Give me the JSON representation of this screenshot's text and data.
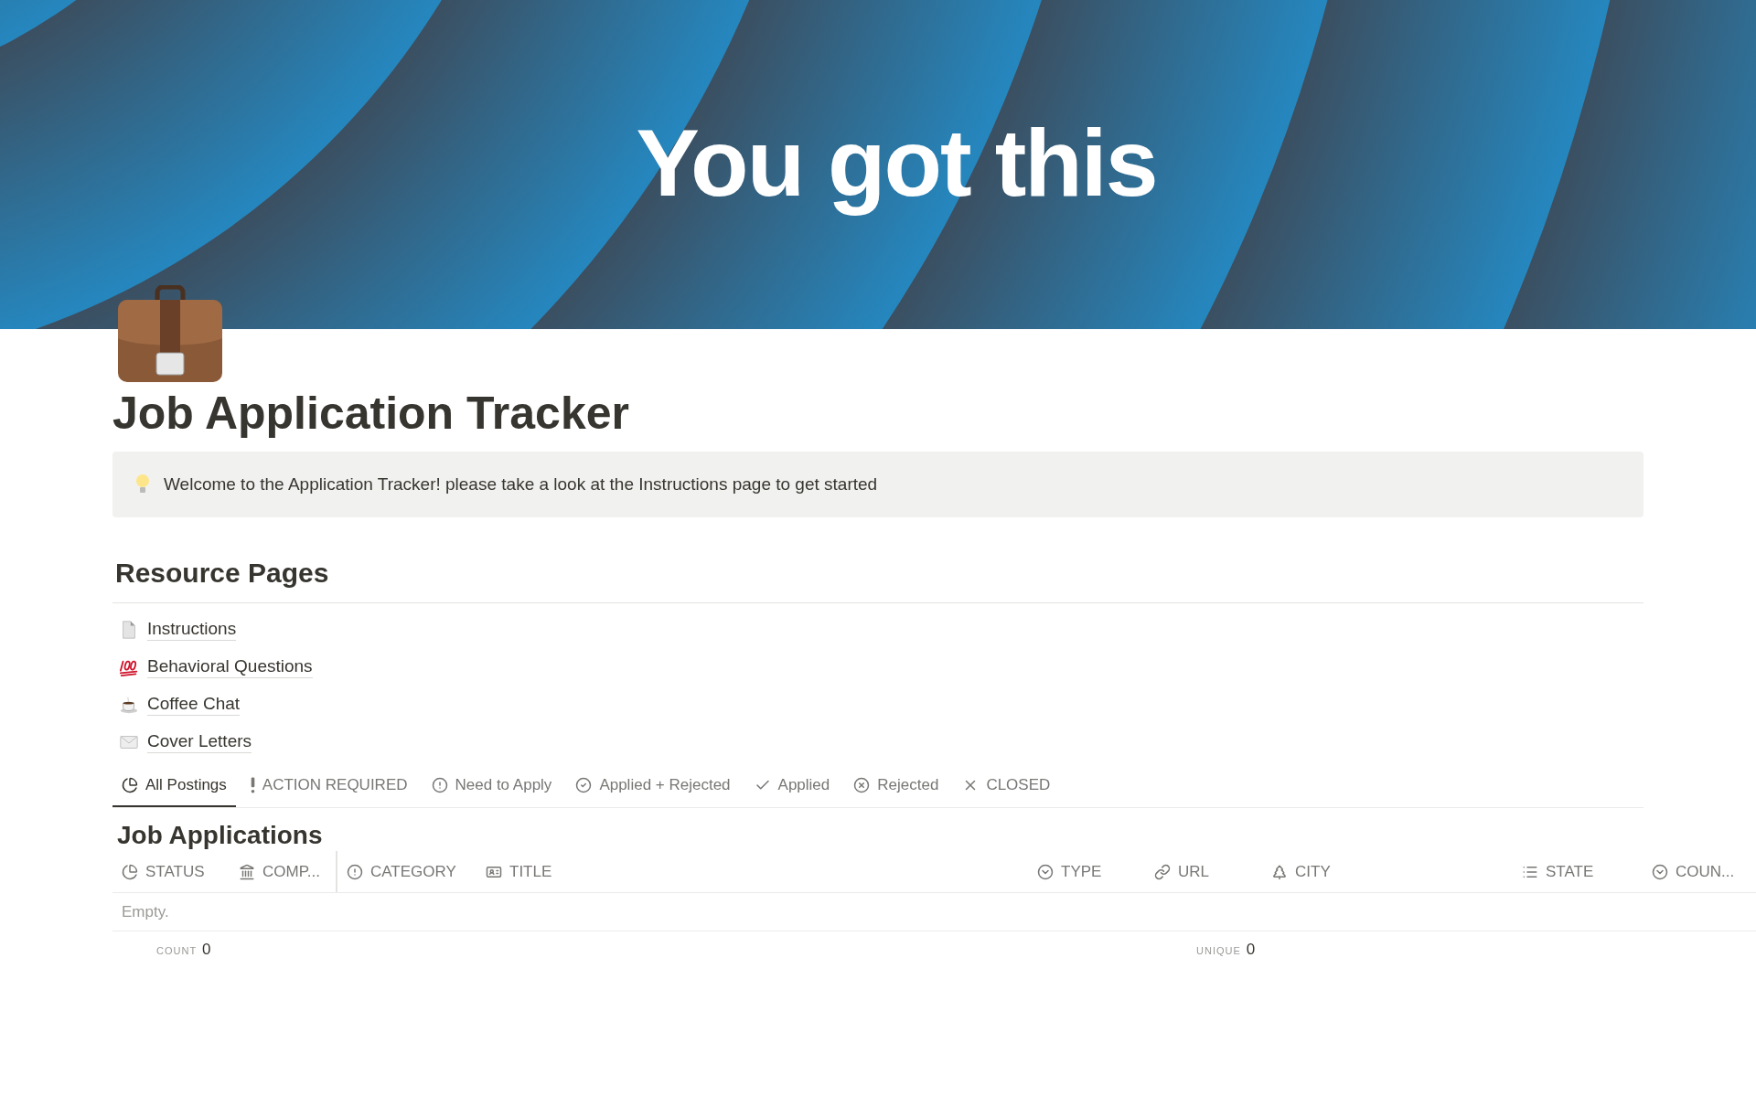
{
  "cover": {
    "title": "You got this"
  },
  "page": {
    "title": "Job Application Tracker"
  },
  "callout": {
    "text": "Welcome to the Application Tracker! please take a look at the Instructions page to get started"
  },
  "resources": {
    "heading": "Resource Pages",
    "links": [
      {
        "kind": "page",
        "label": "Instructions"
      },
      {
        "kind": "hundred",
        "label": "Behavioral Questions"
      },
      {
        "kind": "coffee",
        "label": "Coffee Chat"
      },
      {
        "kind": "envelope",
        "label": "Cover Letters"
      }
    ]
  },
  "views": [
    {
      "kind": "pie",
      "label": "All Postings",
      "selected": true
    },
    {
      "kind": "bang",
      "label": "ACTION REQUIRED",
      "selected": false
    },
    {
      "kind": "alert",
      "label": "Need to Apply",
      "selected": false
    },
    {
      "kind": "checkcircle",
      "label": "Applied + Rejected",
      "selected": false
    },
    {
      "kind": "check",
      "label": "Applied",
      "selected": false
    },
    {
      "kind": "xcircle",
      "label": "Rejected",
      "selected": false
    },
    {
      "kind": "x",
      "label": "CLOSED",
      "selected": false
    }
  ],
  "table": {
    "title": "Job Applications",
    "columns": [
      {
        "kind": "pie",
        "label": "STATUS"
      },
      {
        "kind": "bank",
        "label": "COMP..."
      },
      {
        "kind": "alert",
        "label": "CATEGORY"
      },
      {
        "kind": "card",
        "label": "TITLE"
      },
      {
        "kind": "select",
        "label": "TYPE"
      },
      {
        "kind": "link",
        "label": "URL"
      },
      {
        "kind": "tree",
        "label": "CITY"
      },
      {
        "kind": "list",
        "label": "STATE"
      },
      {
        "kind": "select",
        "label": "COUN..."
      }
    ],
    "empty": "Empty.",
    "footer": [
      {
        "label": "COUNT",
        "value": "0"
      },
      {
        "label": "UNIQUE",
        "value": "0"
      }
    ]
  }
}
